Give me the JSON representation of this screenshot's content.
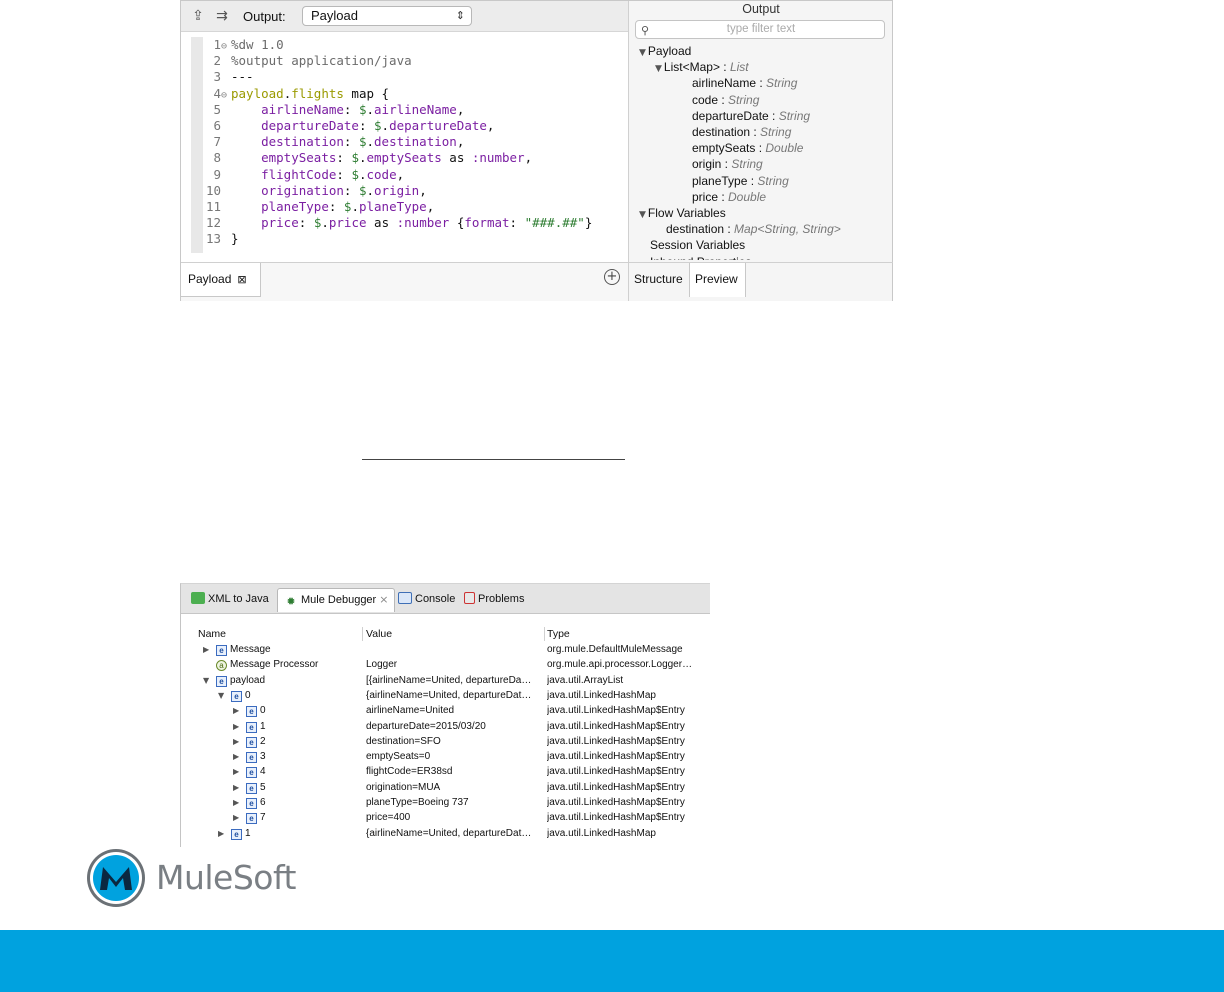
{
  "editor": {
    "toolbar": {
      "export_icon": "export-icon",
      "mapping_icon": "mapping-icon",
      "output_label": "Output:",
      "output_value": "Payload"
    },
    "code_lines": [
      {
        "n": "1",
        "fold": "⊖",
        "parts": [
          {
            "c": "cm",
            "t": "%dw 1.0"
          }
        ]
      },
      {
        "n": "2",
        "fold": "",
        "parts": [
          {
            "c": "cm",
            "t": "%output application/java"
          }
        ]
      },
      {
        "n": "3",
        "fold": "",
        "parts": [
          {
            "c": "op",
            "t": "---"
          }
        ]
      },
      {
        "n": "4",
        "fold": "⊖",
        "parts": [
          {
            "c": "kw",
            "t": "payload"
          },
          {
            "c": "op",
            "t": "."
          },
          {
            "c": "kw",
            "t": "flights"
          },
          {
            "c": "op",
            "t": " map {"
          }
        ]
      },
      {
        "n": "5",
        "fold": "",
        "parts": [
          {
            "c": "op",
            "t": "    "
          },
          {
            "c": "pr",
            "t": "airlineName"
          },
          {
            "c": "op",
            "t": ": "
          },
          {
            "c": "sel",
            "t": "$"
          },
          {
            "c": "op",
            "t": "."
          },
          {
            "c": "pr",
            "t": "airlineName"
          },
          {
            "c": "op",
            "t": ","
          }
        ]
      },
      {
        "n": "6",
        "fold": "",
        "parts": [
          {
            "c": "op",
            "t": "    "
          },
          {
            "c": "pr",
            "t": "departureDate"
          },
          {
            "c": "op",
            "t": ": "
          },
          {
            "c": "sel",
            "t": "$"
          },
          {
            "c": "op",
            "t": "."
          },
          {
            "c": "pr",
            "t": "departureDate"
          },
          {
            "c": "op",
            "t": ","
          }
        ]
      },
      {
        "n": "7",
        "fold": "",
        "parts": [
          {
            "c": "op",
            "t": "    "
          },
          {
            "c": "pr",
            "t": "destination"
          },
          {
            "c": "op",
            "t": ": "
          },
          {
            "c": "sel",
            "t": "$"
          },
          {
            "c": "op",
            "t": "."
          },
          {
            "c": "pr",
            "t": "destination"
          },
          {
            "c": "op",
            "t": ","
          }
        ]
      },
      {
        "n": "8",
        "fold": "",
        "parts": [
          {
            "c": "op",
            "t": "    "
          },
          {
            "c": "pr",
            "t": "emptySeats"
          },
          {
            "c": "op",
            "t": ": "
          },
          {
            "c": "sel",
            "t": "$"
          },
          {
            "c": "op",
            "t": "."
          },
          {
            "c": "pr",
            "t": "emptySeats"
          },
          {
            "c": "op",
            "t": " as "
          },
          {
            "c": "ty",
            "t": ":number"
          },
          {
            "c": "op",
            "t": ","
          }
        ]
      },
      {
        "n": "9",
        "fold": "",
        "parts": [
          {
            "c": "op",
            "t": "    "
          },
          {
            "c": "pr",
            "t": "flightCode"
          },
          {
            "c": "op",
            "t": ": "
          },
          {
            "c": "sel",
            "t": "$"
          },
          {
            "c": "op",
            "t": "."
          },
          {
            "c": "pr",
            "t": "code"
          },
          {
            "c": "op",
            "t": ","
          }
        ]
      },
      {
        "n": "10",
        "fold": "",
        "parts": [
          {
            "c": "op",
            "t": "    "
          },
          {
            "c": "pr",
            "t": "origination"
          },
          {
            "c": "op",
            "t": ": "
          },
          {
            "c": "sel",
            "t": "$"
          },
          {
            "c": "op",
            "t": "."
          },
          {
            "c": "pr",
            "t": "origin"
          },
          {
            "c": "op",
            "t": ","
          }
        ]
      },
      {
        "n": "11",
        "fold": "",
        "parts": [
          {
            "c": "op",
            "t": "    "
          },
          {
            "c": "pr",
            "t": "planeType"
          },
          {
            "c": "op",
            "t": ": "
          },
          {
            "c": "sel",
            "t": "$"
          },
          {
            "c": "op",
            "t": "."
          },
          {
            "c": "pr",
            "t": "planeType"
          },
          {
            "c": "op",
            "t": ","
          }
        ]
      },
      {
        "n": "12",
        "fold": "",
        "parts": [
          {
            "c": "op",
            "t": "    "
          },
          {
            "c": "pr",
            "t": "price"
          },
          {
            "c": "op",
            "t": ": "
          },
          {
            "c": "sel",
            "t": "$"
          },
          {
            "c": "op",
            "t": "."
          },
          {
            "c": "pr",
            "t": "price"
          },
          {
            "c": "op",
            "t": " as "
          },
          {
            "c": "ty",
            "t": ":number"
          },
          {
            "c": "op",
            "t": " {"
          },
          {
            "c": "pr",
            "t": "format"
          },
          {
            "c": "op",
            "t": ": "
          },
          {
            "c": "st",
            "t": "\"###.##\""
          },
          {
            "c": "op",
            "t": "}"
          }
        ]
      },
      {
        "n": "13",
        "fold": "",
        "parts": [
          {
            "c": "op",
            "t": "}"
          }
        ]
      }
    ],
    "bottom_tab": "Payload",
    "bottom_tab_close_icon": "close-icon",
    "add_icon": "plus-circle-icon"
  },
  "output_pane": {
    "title": "Output",
    "filter_placeholder": "type filter text",
    "search_icon": "search-icon",
    "tree": [
      {
        "level": 0,
        "tri": "▼",
        "label": "Payload",
        "type": ""
      },
      {
        "level": 1,
        "tri": "▼",
        "label": "List<Map> : ",
        "type": "List"
      },
      {
        "level": 2,
        "tri": "",
        "label": "airlineName : ",
        "type": "String"
      },
      {
        "level": 2,
        "tri": "",
        "label": "code : ",
        "type": "String"
      },
      {
        "level": 2,
        "tri": "",
        "label": "departureDate : ",
        "type": "String"
      },
      {
        "level": 2,
        "tri": "",
        "label": "destination : ",
        "type": "String"
      },
      {
        "level": 2,
        "tri": "",
        "label": "emptySeats : ",
        "type": "Double"
      },
      {
        "level": 2,
        "tri": "",
        "label": "origin : ",
        "type": "String"
      },
      {
        "level": 2,
        "tri": "",
        "label": "planeType : ",
        "type": "String"
      },
      {
        "level": 2,
        "tri": "",
        "label": "price : ",
        "type": "Double"
      },
      {
        "level": 0,
        "tri": "▼",
        "label": "Flow Variables",
        "type": ""
      },
      {
        "level": 1,
        "tri": "",
        "label": "destination : ",
        "type": "Map<String, String>"
      },
      {
        "level": 0,
        "tri": "",
        "label": "Session Variables",
        "type": ""
      },
      {
        "level": 0,
        "tri": "",
        "label": "Inbound Properties",
        "type": ""
      }
    ],
    "tabs": {
      "structure": "Structure",
      "preview": "Preview"
    }
  },
  "debugger": {
    "tabs": {
      "xml": "XML to Java",
      "mule": "Mule Debugger",
      "console": "Console",
      "problems": "Problems"
    },
    "columns": {
      "name": "Name",
      "value": "Value",
      "type": "Type"
    },
    "rows": [
      {
        "indent": 0,
        "tri": "▶",
        "icon": "e",
        "name": "Message",
        "value": "",
        "type": "org.mule.DefaultMuleMessage"
      },
      {
        "indent": 0,
        "tri": "",
        "icon": "a",
        "name": "Message Processor",
        "value": "Logger",
        "type": "org.mule.api.processor.Logger…"
      },
      {
        "indent": 0,
        "tri": "▼",
        "icon": "e",
        "name": "payload",
        "value": "[{airlineName=United, departureDa…",
        "type": "java.util.ArrayList"
      },
      {
        "indent": 1,
        "tri": "▼",
        "icon": "e",
        "name": "0",
        "value": "{airlineName=United, departureDat…",
        "type": "java.util.LinkedHashMap"
      },
      {
        "indent": 2,
        "tri": "▶",
        "icon": "e",
        "name": "0",
        "value": "airlineName=United",
        "type": "java.util.LinkedHashMap$Entry"
      },
      {
        "indent": 2,
        "tri": "▶",
        "icon": "e",
        "name": "1",
        "value": "departureDate=2015/03/20",
        "type": "java.util.LinkedHashMap$Entry"
      },
      {
        "indent": 2,
        "tri": "▶",
        "icon": "e",
        "name": "2",
        "value": "destination=SFO",
        "type": "java.util.LinkedHashMap$Entry"
      },
      {
        "indent": 2,
        "tri": "▶",
        "icon": "e",
        "name": "3",
        "value": "emptySeats=0",
        "type": "java.util.LinkedHashMap$Entry"
      },
      {
        "indent": 2,
        "tri": "▶",
        "icon": "e",
        "name": "4",
        "value": "flightCode=ER38sd",
        "type": "java.util.LinkedHashMap$Entry"
      },
      {
        "indent": 2,
        "tri": "▶",
        "icon": "e",
        "name": "5",
        "value": "origination=MUA",
        "type": "java.util.LinkedHashMap$Entry"
      },
      {
        "indent": 2,
        "tri": "▶",
        "icon": "e",
        "name": "6",
        "value": "planeType=Boeing 737",
        "type": "java.util.LinkedHashMap$Entry"
      },
      {
        "indent": 2,
        "tri": "▶",
        "icon": "e",
        "name": "7",
        "value": "price=400",
        "type": "java.util.LinkedHashMap$Entry"
      },
      {
        "indent": 1,
        "tri": "▶",
        "icon": "e",
        "name": "1",
        "value": "{airlineName=United, departureDat…",
        "type": "java.util.LinkedHashMap"
      }
    ]
  },
  "branding": {
    "logo_icon": "mulesoft-logo-icon",
    "logo_text": "MuleSoft",
    "footer_color": "#00a2df"
  }
}
